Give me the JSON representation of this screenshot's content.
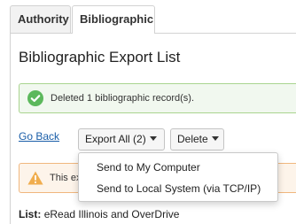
{
  "tabs": [
    {
      "label": "Authority"
    },
    {
      "label": "Bibliographic"
    }
  ],
  "page": {
    "title": "Bibliographic Export List"
  },
  "success_alert": {
    "text": "Deleted 1 bibliographic record(s).",
    "icon": "check-circle-icon",
    "color": "#5cb85c"
  },
  "actions": {
    "go_back": "Go Back",
    "export_all": "Export All (2)",
    "delete": "Delete"
  },
  "export_menu": {
    "items": [
      {
        "label": "Send to My Computer"
      },
      {
        "label": "Send to Local System (via TCP/IP)"
      }
    ]
  },
  "warning_alert": {
    "visible_text": "This ex",
    "icon": "warning-triangle-icon",
    "color": "#f0ad4e"
  },
  "list": {
    "label": "List:",
    "value": "eRead Illinois and OverDrive"
  }
}
